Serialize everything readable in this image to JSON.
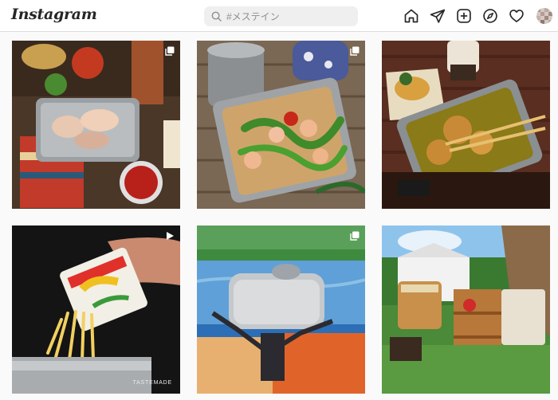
{
  "app": {
    "logo_text": "Instagram"
  },
  "search": {
    "placeholder": "#メステイン",
    "value": ""
  },
  "nav": {
    "icons": [
      "home-icon",
      "send-icon",
      "new-post-icon",
      "explore-icon",
      "heart-icon"
    ]
  },
  "colors": {
    "icon": "#262626",
    "header_bg": "#ffffff",
    "page_bg": "#fafafa",
    "search_bg": "#efefef",
    "border": "#dbdbdb"
  },
  "posts": [
    {
      "kind": "multi-photo"
    },
    {
      "kind": "multi-photo"
    },
    {
      "kind": "photo"
    },
    {
      "kind": "video",
      "watermark": "TASTEMADE"
    },
    {
      "kind": "multi-photo"
    },
    {
      "kind": "photo"
    }
  ]
}
